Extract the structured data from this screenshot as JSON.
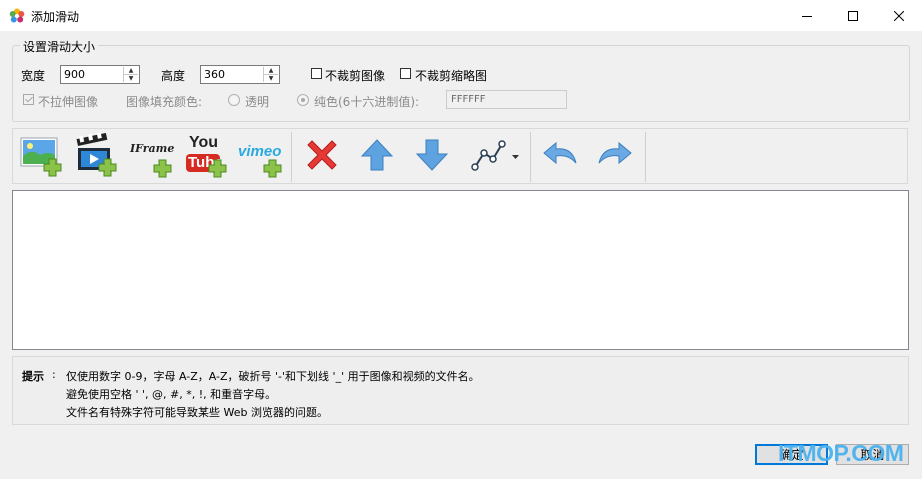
{
  "window": {
    "title": "添加滑动",
    "minimize_icon": "minimize-icon",
    "maximize_icon": "maximize-icon",
    "close_icon": "close-icon"
  },
  "size_group": {
    "title": "设置滑动大小",
    "width_label": "宽度",
    "width_value": "900",
    "height_label": "高度",
    "height_value": "360",
    "no_crop_image_label": "不裁剪图像",
    "no_crop_image_checked": false,
    "no_crop_thumbnail_label": "不裁剪缩略图",
    "no_crop_thumbnail_checked": false,
    "no_stretch_label": "不拉伸图像",
    "no_stretch_checked": true,
    "fill_color_label": "图像填充颜色:",
    "transparent_label": "透明",
    "solid_label": "纯色(6十六进制值):",
    "hex_value": "FFFFFF"
  },
  "toolbar": {
    "items": [
      {
        "icon": "add-image-icon"
      },
      {
        "icon": "add-video-icon"
      },
      {
        "icon": "add-iframe-icon",
        "text": "IFrame"
      },
      {
        "icon": "add-youtube-icon",
        "text_top": "You",
        "text_bottom": "Tube"
      },
      {
        "icon": "add-vimeo-icon",
        "text": "vimeo"
      },
      {
        "icon": "delete-icon"
      },
      {
        "icon": "move-up-icon"
      },
      {
        "icon": "move-down-icon"
      },
      {
        "icon": "transition-icon"
      },
      {
        "icon": "undo-icon"
      },
      {
        "icon": "redo-icon"
      }
    ]
  },
  "hint": {
    "label": "提示",
    "colon": ":",
    "lines": [
      "仅使用数字 0-9，字母 A-Z，A-Z，破折号 '-'和下划线 '_' 用于图像和视频的文件名。",
      "避免使用空格 ' ', @, #, *, !, 和重音字母。",
      "文件名有特殊字符可能导致某些 Web 浏览器的问题。"
    ]
  },
  "buttons": {
    "ok": "确定",
    "cancel": "取消"
  },
  "watermark": "ITMOP.COM",
  "colors": {
    "watermark": "#4bb2f0",
    "default_button_border": "#0078d7"
  }
}
